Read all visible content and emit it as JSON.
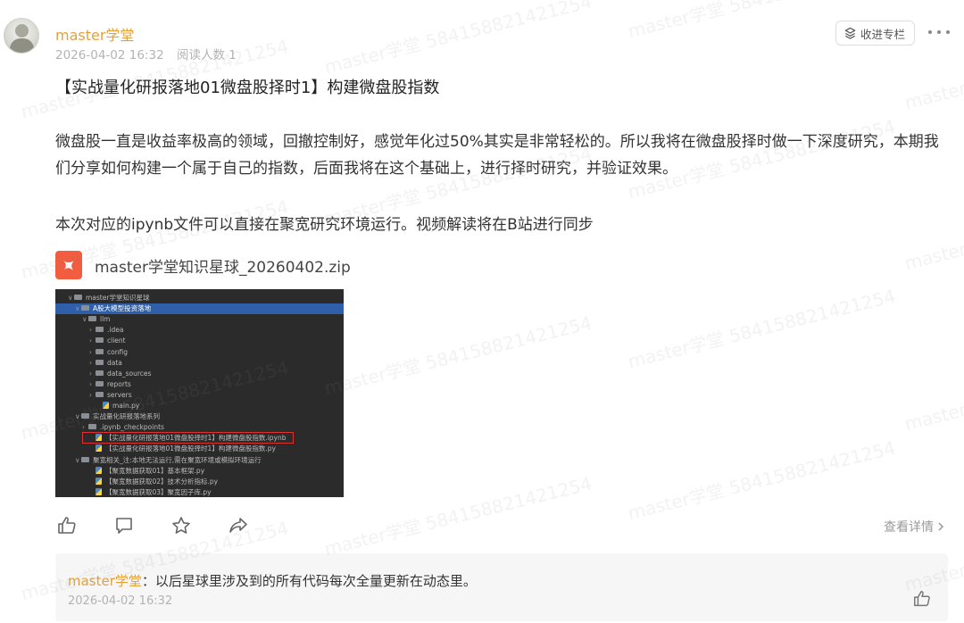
{
  "post": {
    "author": "master学堂",
    "time": "2026-04-02 16:32",
    "reads": "阅读人数 1",
    "collect_label": "收进专栏",
    "title": "【实战量化研报落地01微盘股择时1】构建微盘股指数",
    "paragraph1": "微盘股一直是收益率极高的领域，回撤控制好，感觉年化过50%其实是非常轻松的。所以我将在微盘股择时做一下深度研究，本期我们分享如何构建一个属于自己的指数，后面我将在这个基础上，进行择时研究，并验证效果。",
    "paragraph2": "本次对应的ipynb文件可以直接在聚宽研究环境运行。视频解读将在B站进行同步",
    "attachment": "master学堂知识星球_20260402.zip"
  },
  "screenshot_tree": [
    {
      "indent": 1,
      "arrow": "∨",
      "kind": "folder",
      "label": "master学堂知识星球",
      "selected": false
    },
    {
      "indent": 2,
      "arrow": "∨",
      "kind": "folder",
      "label": "A股大模型投资落地",
      "selected": true
    },
    {
      "indent": 3,
      "arrow": "∨",
      "kind": "folder",
      "label": "llm",
      "selected": false
    },
    {
      "indent": 4,
      "arrow": "›",
      "kind": "folder",
      "label": ".idea",
      "selected": false
    },
    {
      "indent": 4,
      "arrow": "›",
      "kind": "folder",
      "label": "client",
      "selected": false
    },
    {
      "indent": 4,
      "arrow": "›",
      "kind": "folder",
      "label": "config",
      "selected": false
    },
    {
      "indent": 4,
      "arrow": "›",
      "kind": "folder",
      "label": "data",
      "selected": false
    },
    {
      "indent": 4,
      "arrow": "›",
      "kind": "folder",
      "label": "data_sources",
      "selected": false
    },
    {
      "indent": 4,
      "arrow": "›",
      "kind": "folder",
      "label": "reports",
      "selected": false
    },
    {
      "indent": 4,
      "arrow": "›",
      "kind": "folder",
      "label": "servers",
      "selected": false
    },
    {
      "indent": 5,
      "arrow": "",
      "kind": "py",
      "label": "main.py",
      "selected": false
    },
    {
      "indent": 2,
      "arrow": "∨",
      "kind": "folder",
      "label": "实战量化研报落地系列",
      "selected": false
    },
    {
      "indent": 3,
      "arrow": "›",
      "kind": "folder",
      "label": ".ipynb_checkpoints",
      "selected": false
    },
    {
      "indent": 4,
      "arrow": "",
      "kind": "py",
      "label": "【实战量化研报落地01微盘股择时1】构建微盘股指数.ipynb",
      "selected": false
    },
    {
      "indent": 4,
      "arrow": "",
      "kind": "py",
      "label": "【实战量化研报落地01微盘股择时1】构建微盘股指数.py",
      "selected": false
    },
    {
      "indent": 2,
      "arrow": "∨",
      "kind": "folder",
      "label": "聚宽相关_注:本地无法运行,需在聚宽环境或模拟环境运行",
      "selected": false
    },
    {
      "indent": 4,
      "arrow": "",
      "kind": "py",
      "label": "【聚宽数据获取01】基本框架.py",
      "selected": false
    },
    {
      "indent": 4,
      "arrow": "",
      "kind": "py",
      "label": "【聚宽数据获取02】技术分析指标.py",
      "selected": false
    },
    {
      "indent": 4,
      "arrow": "",
      "kind": "py",
      "label": "【聚宽数据获取03】聚宽因子库.py",
      "selected": false
    }
  ],
  "actions": {
    "like_icon": "thumbs-up-icon",
    "comment_icon": "comment-icon",
    "star_icon": "star-icon",
    "share_icon": "share-icon",
    "detail_label": "查看详情"
  },
  "comment": {
    "author": "master学堂",
    "separator": "：",
    "text": "以后星球里涉及到的所有代码每次全量更新在动态里。",
    "time": "2026-04-02 16:32"
  },
  "watermark": "master学堂 584158821421254",
  "colors": {
    "author": "#e5a03e",
    "meta": "#b3b3b3",
    "file_icon": "#f25c3f",
    "tree_selected": "#2f5fa8",
    "highlight_box": "#e03131"
  }
}
